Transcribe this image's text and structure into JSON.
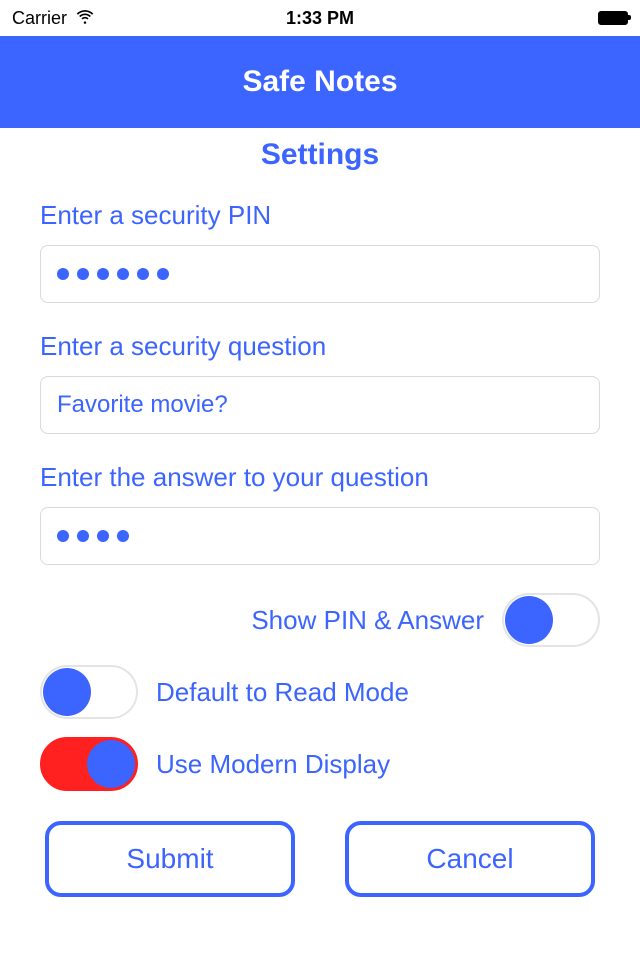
{
  "status": {
    "carrier": "Carrier",
    "time": "1:33 PM"
  },
  "nav": {
    "title": "Safe Notes"
  },
  "page": {
    "title": "Settings"
  },
  "form": {
    "pin_label": "Enter a security PIN",
    "pin_dots": 6,
    "question_label": "Enter a security question",
    "question_value": "Favorite movie?",
    "answer_label": "Enter the answer to your question",
    "answer_dots": 4
  },
  "toggles": {
    "show_pin": {
      "label": "Show PIN & Answer",
      "on": false
    },
    "read_mode": {
      "label": "Default to Read Mode",
      "on": false
    },
    "modern_display": {
      "label": "Use Modern Display",
      "on": true
    }
  },
  "buttons": {
    "submit": "Submit",
    "cancel": "Cancel"
  }
}
